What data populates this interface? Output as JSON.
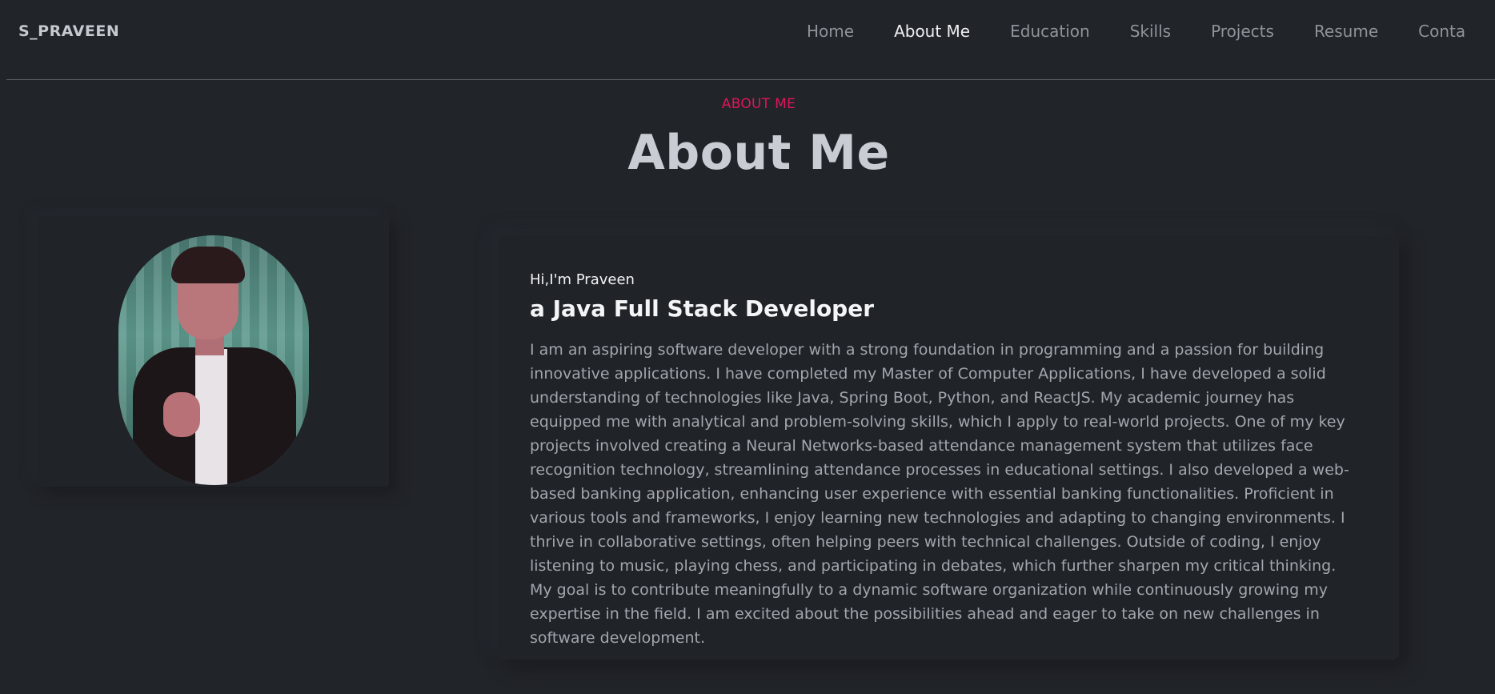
{
  "header": {
    "brand": "S_PRAVEEN",
    "nav": [
      {
        "label": "Home"
      },
      {
        "label": "About Me"
      },
      {
        "label": "Education"
      },
      {
        "label": "Skills"
      },
      {
        "label": "Projects"
      },
      {
        "label": "Resume"
      },
      {
        "label": "Conta"
      }
    ],
    "active_nav": "About Me"
  },
  "about": {
    "kicker": "ABOUT ME",
    "title": "About Me",
    "greeting": "Hi,I'm Praveen",
    "role": "a Java Full Stack Developer",
    "bio": "I am an aspiring software developer with a strong foundation in programming and a passion for building innovative applications. I have completed my Master of Computer Applications, I have developed a solid understanding of technologies like Java, Spring Boot, Python, and ReactJS. My academic journey has equipped me with analytical and problem-solving skills, which I apply to real-world projects. One of my key projects involved creating a Neural Networks-based attendance management system that utilizes face recognition technology, streamlining attendance processes in educational settings. I also developed a web-based banking application, enhancing user experience with essential banking functionalities. Proficient in various tools and frameworks, I enjoy learning new technologies and adapting to changing environments. I thrive in collaborative settings, often helping peers with technical challenges. Outside of coding, I enjoy listening to music, playing chess, and participating in debates, which further sharpen my critical thinking. My goal is to contribute meaningfully to a dynamic software organization while continuously growing my expertise in the field. I am excited about the possibilities ahead and eager to take on new challenges in software development."
  },
  "colors": {
    "background": "#212429",
    "accent": "#e0155a",
    "active_nav": "#eef0f2",
    "nav": "#8f949b"
  }
}
